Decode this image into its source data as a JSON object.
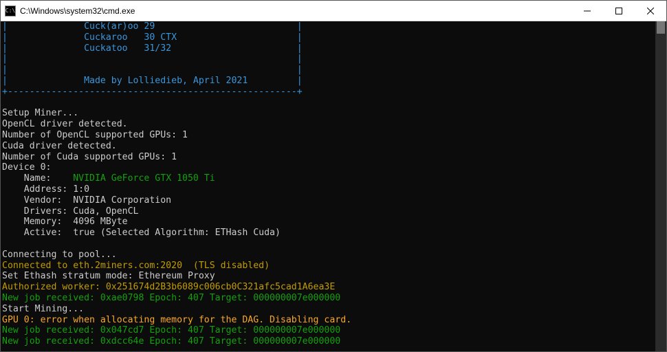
{
  "window": {
    "title": "C:\\Windows\\system32\\cmd.exe",
    "icon_text": "C:\\"
  },
  "header_box": {
    "rows": [
      "|              Cuck(ar)oo 29                          |",
      "|              Cuckaroo   30 CTX                      |",
      "|              Cuckatoo   31/32                       |",
      "|                                                     |",
      "|                                                     |",
      "|              Made by Lolliedieb, April 2021         |",
      "+-----------------------------------------------------+"
    ]
  },
  "log": {
    "setup": "Setup Miner...",
    "opencl_detected": "OpenCL driver detected.",
    "opencl_gpus": "Number of OpenCL supported GPUs: 1",
    "cuda_detected": "Cuda driver detected.",
    "cuda_gpus": "Number of Cuda supported GPUs: 1",
    "device": "Device 0:",
    "name_label": "    Name:    ",
    "name_value": "NVIDIA GeForce GTX 1050 Ti",
    "address": "    Address: 1:0",
    "vendor": "    Vendor:  NVIDIA Corporation",
    "drivers": "    Drivers: Cuda, OpenCL",
    "memory": "    Memory:  4096 MByte",
    "active": "    Active:  true (Selected Algorithm: ETHash Cuda)",
    "blank": "",
    "connecting": "Connecting to pool...",
    "connected": "Connected to eth.2miners.com:2020  (TLS disabled)",
    "stratum": "Set Ethash stratum mode: Ethereum Proxy",
    "auth": "Authorized worker: 0x251674d2B3b6089c006cb0C321afc5cad1A6ea3E",
    "job1": "New job received: 0xae0798 Epoch: 407 Target: 000000007e000000",
    "start": "Start Mining...",
    "gpu_err": "GPU 0: error when allocating memory for the DAG. Disabling card.",
    "job2": "New job received: 0x047cd7 Epoch: 407 Target: 000000007e000000",
    "job3": "New job received: 0xdcc64e Epoch: 407 Target: 000000007e000000"
  }
}
